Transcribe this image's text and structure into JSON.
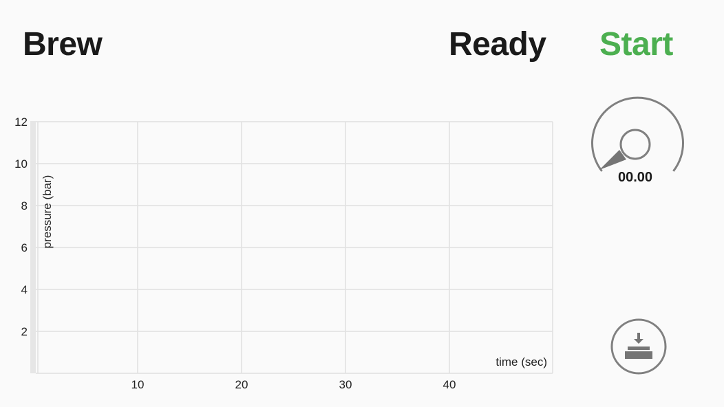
{
  "header": {
    "title": "Brew",
    "status": "Ready",
    "start_label": "Start"
  },
  "colors": {
    "accent": "#4caf50",
    "text": "#1a1a1a",
    "grid": "#e0e0e0",
    "icon": "#757575"
  },
  "gauge": {
    "value": "00.00",
    "icon": "gauge-dial-icon"
  },
  "tare_button": {
    "icon": "scale-tare-icon"
  },
  "chart_data": {
    "type": "line",
    "xlabel": "time (sec)",
    "ylabel": "pressure (bar)",
    "xlim": [
      0,
      50
    ],
    "ylim": [
      0,
      12
    ],
    "x_ticks": [
      10,
      20,
      30,
      40
    ],
    "y_ticks": [
      2,
      4,
      6,
      8,
      10,
      12
    ],
    "grid": true,
    "series": []
  }
}
